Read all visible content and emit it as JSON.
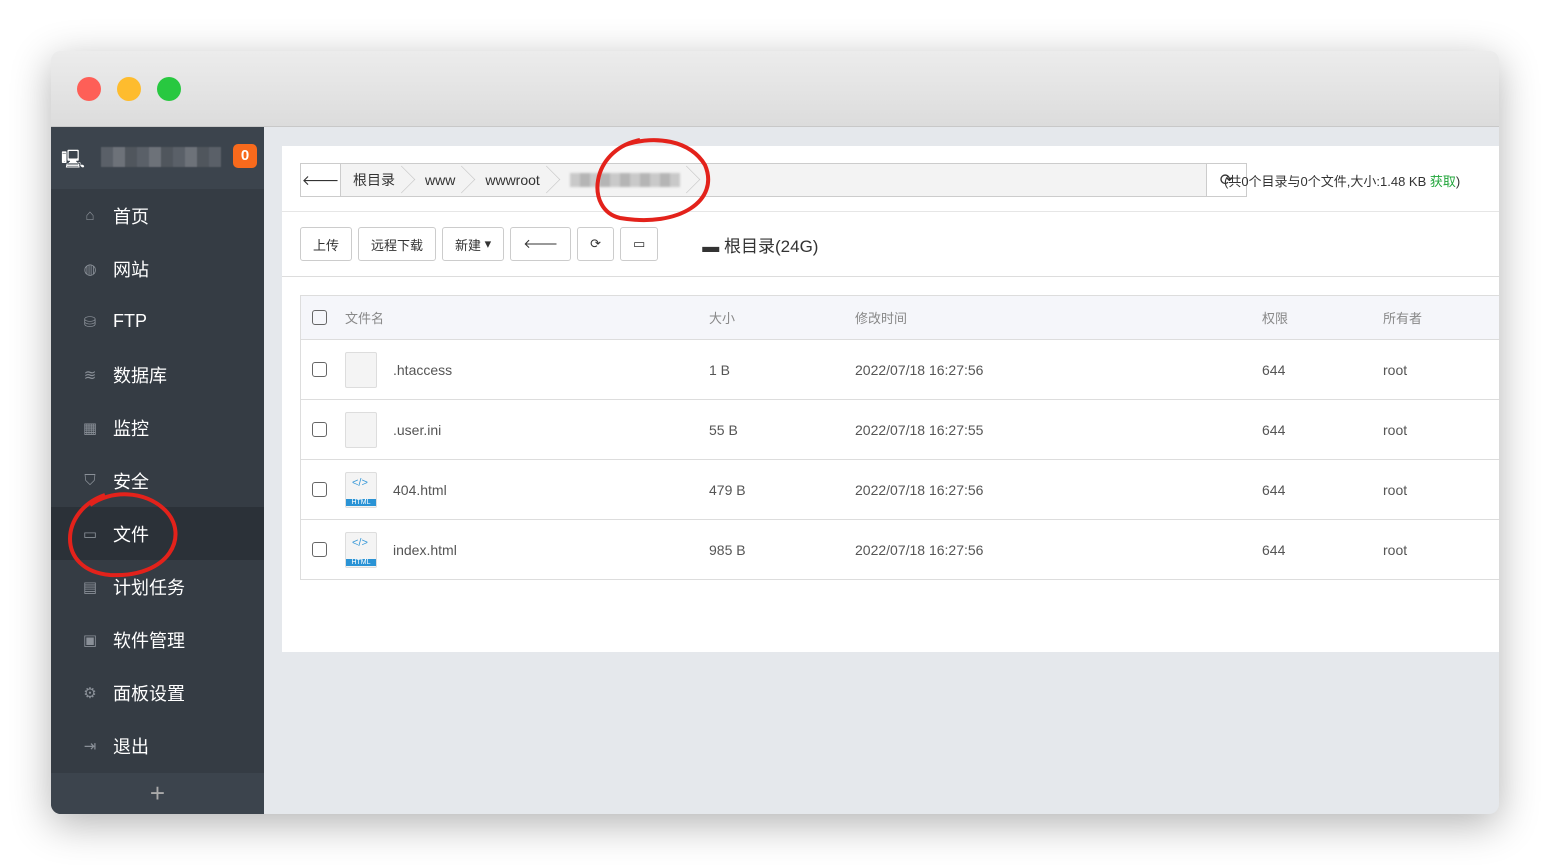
{
  "sidebar": {
    "badge": "0",
    "items": [
      {
        "label": "首页",
        "icon": "home-icon"
      },
      {
        "label": "网站",
        "icon": "globe-icon"
      },
      {
        "label": "FTP",
        "icon": "ftp-icon"
      },
      {
        "label": "数据库",
        "icon": "database-icon"
      },
      {
        "label": "监控",
        "icon": "monitor-icon"
      },
      {
        "label": "安全",
        "icon": "shield-icon"
      },
      {
        "label": "文件",
        "icon": "folder-icon"
      },
      {
        "label": "计划任务",
        "icon": "calendar-icon"
      },
      {
        "label": "软件管理",
        "icon": "apps-icon"
      },
      {
        "label": "面板设置",
        "icon": "gear-icon"
      },
      {
        "label": "退出",
        "icon": "logout-icon"
      }
    ],
    "add": "+"
  },
  "breadcrumb": [
    "根目录",
    "www",
    "wwwroot"
  ],
  "info": {
    "text": "(共0个目录与0个文件,大小:1.48 KB ",
    "get": "获取",
    ")": ")"
  },
  "toolbar": {
    "upload": "上传",
    "remote_download": "远程下载",
    "new": "新建",
    "disk": "根目录(24G)"
  },
  "table": {
    "headers": [
      "文件名",
      "大小",
      "修改时间",
      "权限",
      "所有者"
    ],
    "rows": [
      {
        "name": ".htaccess",
        "size": "1 B",
        "time": "2022/07/18 16:27:56",
        "perm": "644",
        "owner": "root",
        "type": "file"
      },
      {
        "name": ".user.ini",
        "size": "55 B",
        "time": "2022/07/18 16:27:55",
        "perm": "644",
        "owner": "root",
        "type": "file"
      },
      {
        "name": "404.html",
        "size": "479 B",
        "time": "2022/07/18 16:27:56",
        "perm": "644",
        "owner": "root",
        "type": "html"
      },
      {
        "name": "index.html",
        "size": "985 B",
        "time": "2022/07/18 16:27:56",
        "perm": "644",
        "owner": "root",
        "type": "html"
      }
    ]
  },
  "html_badge": "HTML"
}
